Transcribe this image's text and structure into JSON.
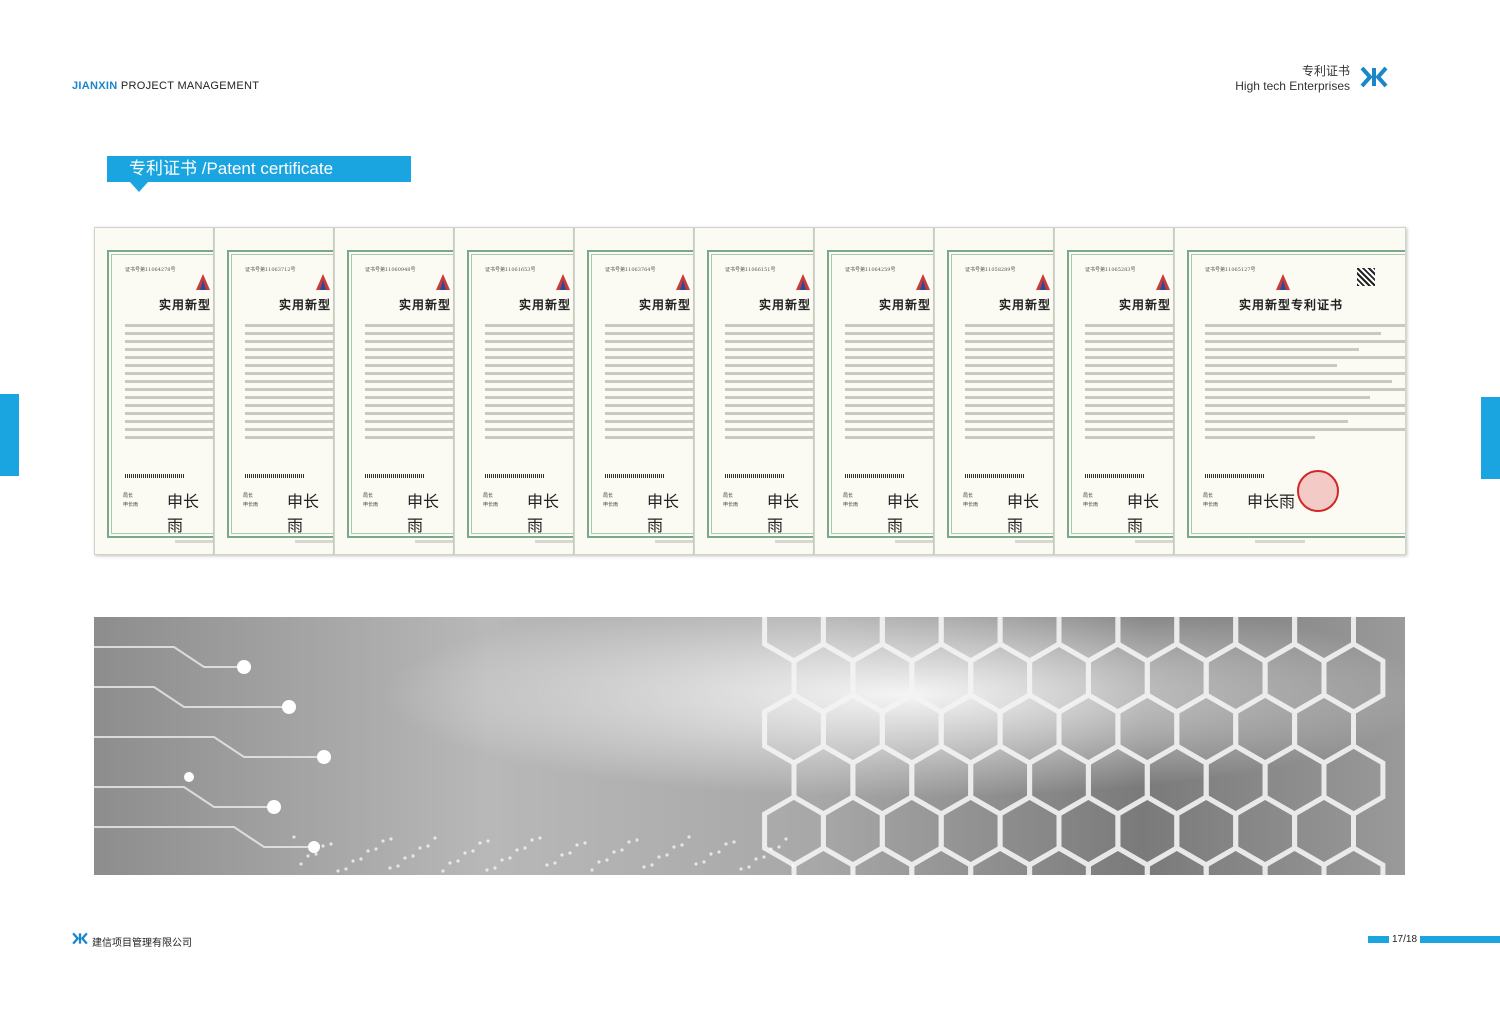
{
  "header": {
    "brand_strong": "JIANXIN",
    "brand_rest": "PROJECT MANAGEMENT",
    "right_line1": "专利证书",
    "right_line2": "High tech Enterprises"
  },
  "section": {
    "title": "专利证书 /Patent certificate"
  },
  "certificates": [
    {
      "number": "证书号第11064278号",
      "title": "实用新型"
    },
    {
      "number": "证书号第11063712号",
      "title": "实用新型"
    },
    {
      "number": "证书号第11060948号",
      "title": "实用新型"
    },
    {
      "number": "证书号第11061653号",
      "title": "实用新型"
    },
    {
      "number": "证书号第11063764号",
      "title": "实用新型"
    },
    {
      "number": "证书号第11066151号",
      "title": "实用新型"
    },
    {
      "number": "证书号第11064259号",
      "title": "实用新型"
    },
    {
      "number": "证书号第11058289号",
      "title": "实用新型"
    },
    {
      "number": "证书号第11065283号",
      "title": "实用新型"
    },
    {
      "number": "证书号第11065127号",
      "title": "实用新型专利证书"
    }
  ],
  "certificate_common": {
    "signature": "申长雨",
    "sign_label_1": "局长",
    "sign_label_2": "申长雨"
  },
  "footer": {
    "company": "建信项目管理有限公司",
    "page": "17/18"
  },
  "colors": {
    "accent": "#1aa5e0",
    "brand": "#1b87c9"
  }
}
